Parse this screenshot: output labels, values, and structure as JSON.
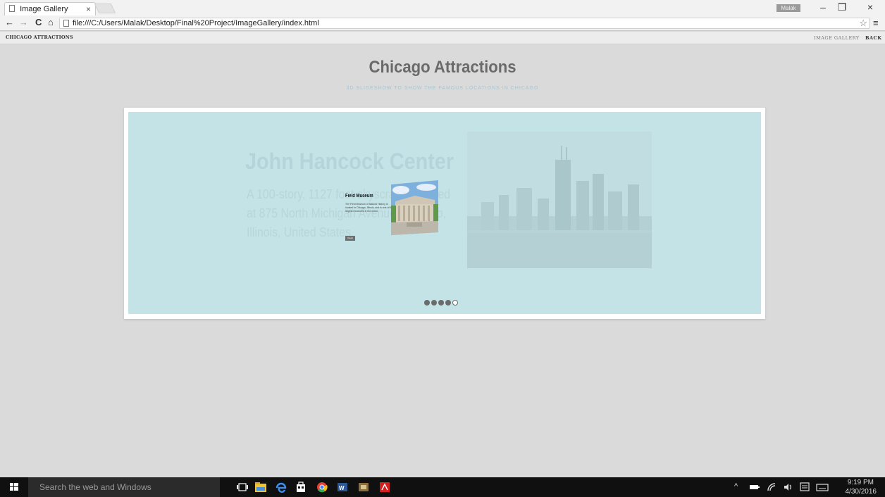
{
  "browser": {
    "tab_title": "Image Gallery",
    "tab_close": "×",
    "user_badge": "Malak",
    "minimize": "–",
    "restore": "❐",
    "close": "×",
    "back": "←",
    "forward": "→",
    "reload": "C",
    "home": "⌂",
    "url": "file:///C:/Users/Malak/Desktop/Final%20Project/ImageGallery/index.html",
    "bookmark": "☆",
    "menu": "≡"
  },
  "nav": {
    "brand": "CHICAGO ATTRACTIONS",
    "links": [
      "IMAGE GALLERY",
      "BACK"
    ]
  },
  "header": {
    "title": "Chicago Attractions",
    "subtitle": "3D SLIDESHOW TO SHOW THE FAMOUS LOCATIONS IN CHICAGO"
  },
  "slideshow": {
    "background_slide": {
      "title": "John Hancock Center",
      "text": "A 100-story, 1127 foot skyscraper located at 875 North Michigan Avenue, Chicago, Illinois, United States."
    },
    "active_slide": {
      "title": "Field Museum",
      "text": "The Field Museum of Natural History is located in Chicago, Illinois, and is one of the largest museums in the world.",
      "button": "Read"
    },
    "dots": {
      "total": 5,
      "active_index": 4
    },
    "colors": {
      "stage": "#c4e3e7",
      "frame": "#ffffff"
    }
  },
  "taskbar": {
    "search_placeholder": "Search the web and Windows",
    "time": "9:19 PM",
    "date": "4/30/2016"
  }
}
